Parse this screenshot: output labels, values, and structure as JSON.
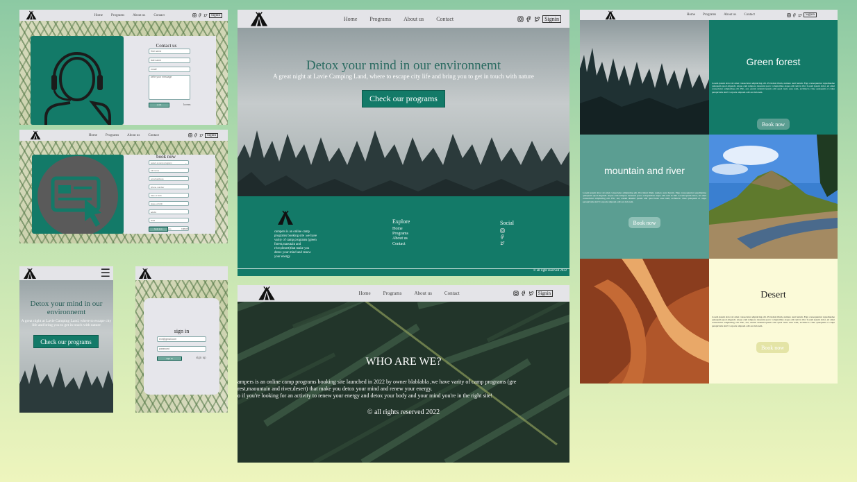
{
  "nav": {
    "home": "Home",
    "programs": "Programs",
    "about": "About us",
    "contact": "Contact",
    "signin": "Signin"
  },
  "contact": {
    "title": "Contact us",
    "fields": [
      "first name",
      "last name",
      "email"
    ],
    "message_placeholder": "write your message",
    "button": "send",
    "link": "lorem"
  },
  "booking": {
    "title": "book now",
    "select_placeholder": "select a camp program",
    "fields": [
      "full name",
      "email address",
      "phone number",
      "date of birth",
      "place of birth",
      "adults",
      "child",
      "number of participants"
    ],
    "button": "book now",
    "link": "cancel"
  },
  "mobile_home": {
    "title": "Detox your mind in our environnemt",
    "subtitle": "A great night at Lavie Camping Land, where to escape city life and bring you to get in touch with nature",
    "button": "Check our programs"
  },
  "mobile_signin": {
    "title": "sign in",
    "email_placeholder": "exe@gmail.com",
    "password_placeholder": "password",
    "button": "sign in",
    "link": "sign up"
  },
  "hero": {
    "title": "Detox your mind in our environnemt",
    "subtitle": "A great night at Lavie Camping Land, where to escape city life and bring you to get in touch with nature",
    "button": "Check our programs"
  },
  "footer": {
    "description": "campers is an online camp programs booking site .we have varity of camp programs (green forest,maoutain and river,desert)that make you detox your mind and renew your energy",
    "explore_title": "Explore",
    "explore_links": [
      "Home",
      "Programs",
      "About us",
      "Contact"
    ],
    "social_title": "Social",
    "copyright": "© all right reserved 2022"
  },
  "about": {
    "title": "WHO ARE WE?",
    "line1": "ampers is an online camp programs booking site launched in 2022 by owner blablabla ,we have varity of camp programs (gre",
    "line2": "rest,maountain and river,desert) that make you detox your mind and renew your energy.",
    "line3": "o if you're looking for an activity to renew your energy and detox your body and your mind you're in the right site!",
    "copyright": "© all rights reserved 2022"
  },
  "programs": [
    {
      "title": "Green forest",
      "text": "Lorem ipsum dolor sit amet consectetur adipisicing elit. Provident illum, numero sunt harum. Eiga consequuntur repudiandae quisquam quod eligendi. Atque cum tempore deserunt porro voluptatibus atque odit rem in illo! Lorem ipsum dolor, sit amet consectetur adipisicing elit. Hic, aut, earum deleniti ipsum odit quod iusto esse nam, architecto vitae quisquam et culpa perspiciatis sint! Corporis aliquam odit aut dolorem.",
      "button": "Book now"
    },
    {
      "title": "mountain and river",
      "text": "Lorem ipsum dolor sit amet consectetur adipisicing elit. Provident illum, numero sunt harum. Eiga consequuntur repudiandae quisquam quod eligendi. Atque cum tempore deserunt porro voluptatibus atque odit rem in illo! Lorem ipsum dolor, sit amet consectetur adipisicing elit. Hic, aut, earum deleniti ipsum odit quod iusto esse nam, architecto vitae quisquam et culpa perspiciatis sint! Corporis aliquam odit aut dolorem.",
      "button": "Book now"
    },
    {
      "title": "Desert",
      "text": "Lorem ipsum dolor sit amet consectetur adipisicing elit. Provident illum, numero sunt harum. Eiga consequuntur repudiandae quisquam quod eligendi. Atque cum tempore deserunt porro voluptatibus atque odit rem in illo! Lorem ipsum dolor, sit amet consectetur adipisicing elit. Hic, aut, earum deleniti ipsum odit quod iusto esse nam, architecto vitae quisquam et culpa perspiciatis sint! Corporis aliquam odit aut dolorem.",
      "button": "Book now"
    }
  ],
  "colors": {
    "brand_green": "#137a68",
    "mountain_teal": "#5b9e92",
    "desert_cream": "#fbfad8",
    "nav_gray": "#e4e4e8"
  }
}
